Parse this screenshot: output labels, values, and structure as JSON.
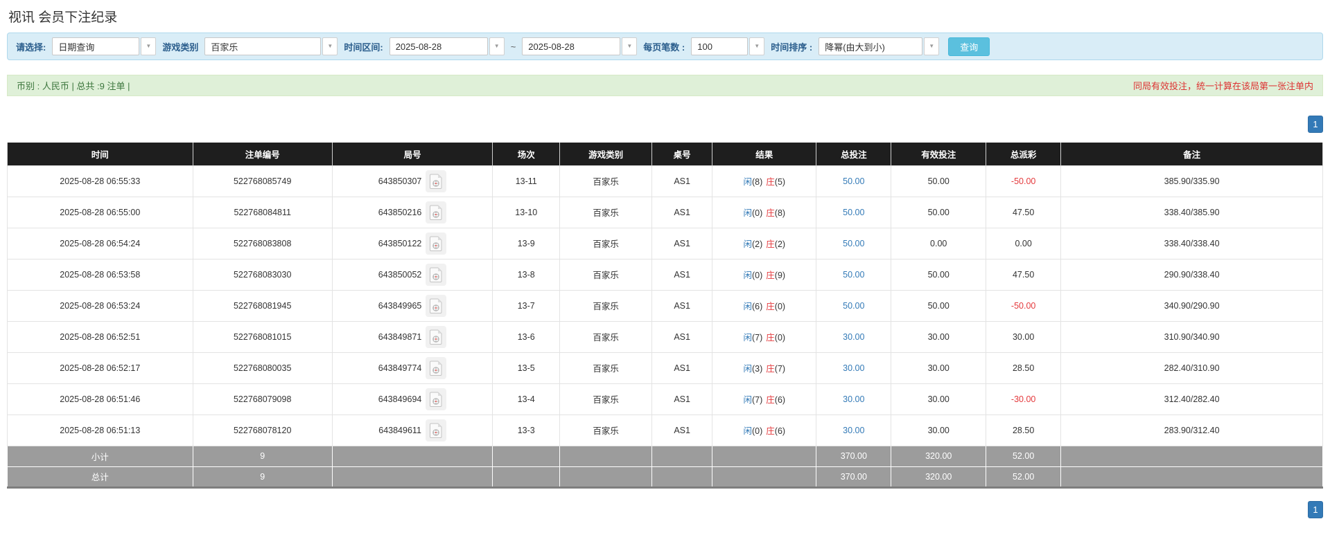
{
  "page": {
    "title": "视讯 会员下注纪录"
  },
  "colors": {
    "filter_bg": "#d9edf7",
    "search_button_blue": "#5bc0de",
    "summary_bg": "#dff0d8",
    "summary_text_green": "#3c763d",
    "note_red": "#dd3333",
    "header_bg_black": "#1e1e1e",
    "link_blue": "#337ab7",
    "player_blue": "#337ab7",
    "banker_red": "#e4393c",
    "negative_red": "#e4393c",
    "totals_bg_grey": "#9c9c9c",
    "pagination_blue": "#337ab7"
  },
  "filters": {
    "select_label": "请选择:",
    "select_value": "日期查询",
    "game_type_label": "游戏类别",
    "game_type_value": "百家乐",
    "date_range_label": "时间区间:",
    "date_from": "2025-08-28",
    "tilde": "~",
    "date_to": "2025-08-28",
    "per_page_label": "每页笔数 :",
    "per_page_value": "100",
    "sort_label": "时间排序 :",
    "sort_value": "降幂(由大到小)",
    "search_button": "查询",
    "caret": "▼"
  },
  "summary": {
    "left_text": "币别 : 人民币 | 总共 :9 注单 |",
    "right_note": "同局有效投注，统一计算在该局第一张注单内"
  },
  "pagination": {
    "page": "1"
  },
  "table": {
    "headers": [
      "时间",
      "注单编号",
      "局号",
      "场次",
      "游戏类别",
      "桌号",
      "结果",
      "总投注",
      "有效投注",
      "总派彩",
      "备注"
    ],
    "rows": [
      {
        "time": "2025-08-28 06:55:33",
        "bet_id": "522768085749",
        "round_id": "643850307",
        "session": "13-11",
        "game": "百家乐",
        "table_no": "AS1",
        "result": {
          "p_label": "闲",
          "p_val": "(8)",
          "b_label": "庄",
          "b_val": "(5)"
        },
        "total_bet": "50.00",
        "valid_bet": "50.00",
        "payout": "-50.00",
        "remark": "385.90/335.90"
      },
      {
        "time": "2025-08-28 06:55:00",
        "bet_id": "522768084811",
        "round_id": "643850216",
        "session": "13-10",
        "game": "百家乐",
        "table_no": "AS1",
        "result": {
          "p_label": "闲",
          "p_val": "(0)",
          "b_label": "庄",
          "b_val": "(8)"
        },
        "total_bet": "50.00",
        "valid_bet": "50.00",
        "payout": "47.50",
        "remark": "338.40/385.90"
      },
      {
        "time": "2025-08-28 06:54:24",
        "bet_id": "522768083808",
        "round_id": "643850122",
        "session": "13-9",
        "game": "百家乐",
        "table_no": "AS1",
        "result": {
          "p_label": "闲",
          "p_val": "(2)",
          "b_label": "庄",
          "b_val": "(2)"
        },
        "total_bet": "50.00",
        "valid_bet": "0.00",
        "payout": "0.00",
        "remark": "338.40/338.40"
      },
      {
        "time": "2025-08-28 06:53:58",
        "bet_id": "522768083030",
        "round_id": "643850052",
        "session": "13-8",
        "game": "百家乐",
        "table_no": "AS1",
        "result": {
          "p_label": "闲",
          "p_val": "(0)",
          "b_label": "庄",
          "b_val": "(9)"
        },
        "total_bet": "50.00",
        "valid_bet": "50.00",
        "payout": "47.50",
        "remark": "290.90/338.40"
      },
      {
        "time": "2025-08-28 06:53:24",
        "bet_id": "522768081945",
        "round_id": "643849965",
        "session": "13-7",
        "game": "百家乐",
        "table_no": "AS1",
        "result": {
          "p_label": "闲",
          "p_val": "(6)",
          "b_label": "庄",
          "b_val": "(0)"
        },
        "total_bet": "50.00",
        "valid_bet": "50.00",
        "payout": "-50.00",
        "remark": "340.90/290.90"
      },
      {
        "time": "2025-08-28 06:52:51",
        "bet_id": "522768081015",
        "round_id": "643849871",
        "session": "13-6",
        "game": "百家乐",
        "table_no": "AS1",
        "result": {
          "p_label": "闲",
          "p_val": "(7)",
          "b_label": "庄",
          "b_val": "(0)"
        },
        "total_bet": "30.00",
        "valid_bet": "30.00",
        "payout": "30.00",
        "remark": "310.90/340.90"
      },
      {
        "time": "2025-08-28 06:52:17",
        "bet_id": "522768080035",
        "round_id": "643849774",
        "session": "13-5",
        "game": "百家乐",
        "table_no": "AS1",
        "result": {
          "p_label": "闲",
          "p_val": "(3)",
          "b_label": "庄",
          "b_val": "(7)"
        },
        "total_bet": "30.00",
        "valid_bet": "30.00",
        "payout": "28.50",
        "remark": "282.40/310.90"
      },
      {
        "time": "2025-08-28 06:51:46",
        "bet_id": "522768079098",
        "round_id": "643849694",
        "session": "13-4",
        "game": "百家乐",
        "table_no": "AS1",
        "result": {
          "p_label": "闲",
          "p_val": "(7)",
          "b_label": "庄",
          "b_val": "(6)"
        },
        "total_bet": "30.00",
        "valid_bet": "30.00",
        "payout": "-30.00",
        "remark": "312.40/282.40"
      },
      {
        "time": "2025-08-28 06:51:13",
        "bet_id": "522768078120",
        "round_id": "643849611",
        "session": "13-3",
        "game": "百家乐",
        "table_no": "AS1",
        "result": {
          "p_label": "闲",
          "p_val": "(0)",
          "b_label": "庄",
          "b_val": "(6)"
        },
        "total_bet": "30.00",
        "valid_bet": "30.00",
        "payout": "28.50",
        "remark": "283.90/312.40"
      }
    ],
    "subtotal": {
      "label": "小计",
      "count": "9",
      "total_bet": "370.00",
      "valid_bet": "320.00",
      "payout": "52.00"
    },
    "total": {
      "label": "总计",
      "count": "9",
      "total_bet": "370.00",
      "valid_bet": "320.00",
      "payout": "52.00"
    }
  }
}
